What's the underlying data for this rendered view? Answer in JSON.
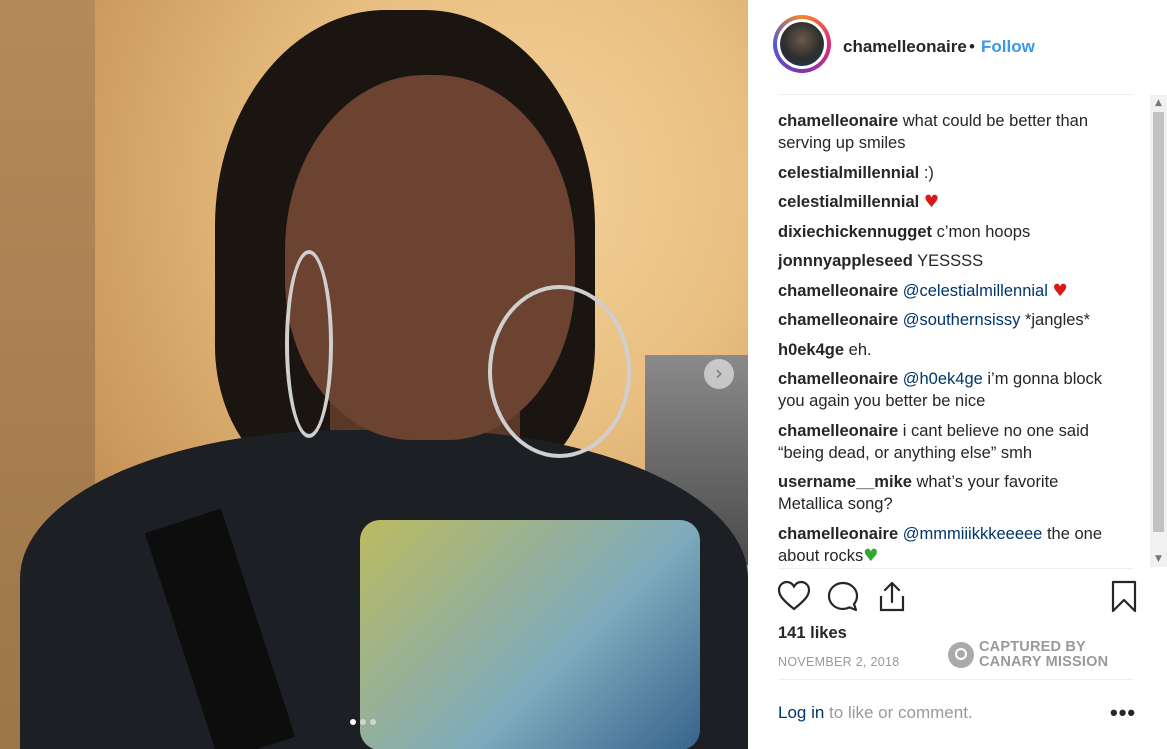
{
  "header": {
    "username": "chamelleonaire",
    "separator": "•",
    "follow_label": "Follow"
  },
  "comments": [
    {
      "user": "chamelleonaire",
      "mention": "",
      "text": "what could be better than serving up smiles",
      "emoji": ""
    },
    {
      "user": "celestialmillennial",
      "mention": "",
      "text": ":)",
      "emoji": ""
    },
    {
      "user": "celestialmillennial",
      "mention": "",
      "text": "",
      "emoji": "red-heart"
    },
    {
      "user": "dixiechickennugget",
      "mention": "",
      "text": "c’mon hoops",
      "emoji": ""
    },
    {
      "user": "jonnnyappleseed",
      "mention": "",
      "text": "YESSSS",
      "emoji": ""
    },
    {
      "user": "chamelleonaire",
      "mention": "@celestialmillennial",
      "text": "",
      "emoji": "red-heart"
    },
    {
      "user": "chamelleonaire",
      "mention": "@southernsissy",
      "text": "*jangles*",
      "emoji": ""
    },
    {
      "user": "h0ek4ge",
      "mention": "",
      "text": "eh.",
      "emoji": ""
    },
    {
      "user": "chamelleonaire",
      "mention": "@h0ek4ge",
      "text": "i’m gonna block you again you better be nice",
      "emoji": ""
    },
    {
      "user": "chamelleonaire",
      "mention": "",
      "text": "i cant believe no one said “being dead, or anything else” smh",
      "emoji": ""
    },
    {
      "user": "username__mike",
      "mention": "",
      "text": "what’s your favorite Metallica song?",
      "emoji": ""
    },
    {
      "user": "chamelleonaire",
      "mention": "@mmmiiikkkeeeee",
      "text": "the one about rocks",
      "emoji": "green-heart"
    }
  ],
  "icons": {
    "like": "heart-outline-icon",
    "comment": "speech-bubble-icon",
    "share": "share-icon",
    "save": "bookmark-icon",
    "next": "chevron-right-icon"
  },
  "likes": "141 likes",
  "date": "NOVEMBER 2, 2018",
  "watermark": {
    "line1": "CAPTURED BY",
    "line2": "CANARY MISSION"
  },
  "footer": {
    "login_link": "Log in",
    "login_text": " to like or comment.",
    "more": "•••"
  },
  "colors": {
    "link": "#3897f0",
    "mention": "#003569",
    "muted": "#999999",
    "text": "#262626"
  }
}
